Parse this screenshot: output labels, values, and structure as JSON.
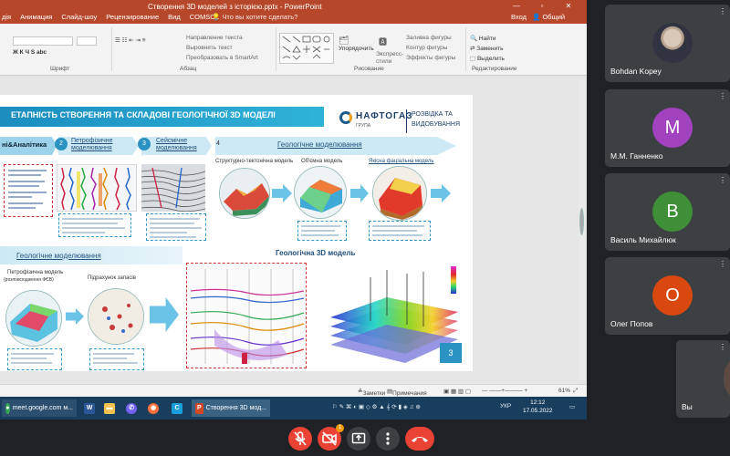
{
  "powerpoint": {
    "title": "Створення 3D моделей з історією.pptx - PowerPoint",
    "tabs": [
      "дія",
      "Анимация",
      "Слайд-шоу",
      "Рецензирование",
      "Вид",
      "COMSOL"
    ],
    "search_hint": "Что вы хотите сделать?",
    "login": "Вход",
    "share": "Общий доступ",
    "window_buttons": [
      "—",
      "▫",
      "✕"
    ],
    "ribbon": {
      "font_group": "Шрифт",
      "paragraph_group": "Абзац",
      "drawing_group": "Рисование",
      "editing_group": "Редактирование",
      "paragraph_items": [
        "Направление текста",
        "Выровнять текст",
        "Преобразовать в SmartArt"
      ],
      "arrange": "Упорядочить",
      "express_styles": "Экспресс-стили",
      "shape_items": [
        "Заливка фигуры",
        "Контур фигуры",
        "Эффекты фигуры"
      ],
      "editing_items": [
        "Найти",
        "Заменить",
        "Выделить"
      ]
    },
    "status": {
      "notes": "Заметки",
      "comments": "Примечания",
      "zoom": "61%"
    }
  },
  "slide": {
    "title": "ЕТАПНІСТЬ СТВОРЕННЯ ТА СКЛАДОВІ ГЕОЛОГІЧНОЇ 3D МОДЕЛІ",
    "logo_brand": "НАФТОГАЗ",
    "logo_sub": "ГРУПА",
    "logo_tag": [
      "РОЗВІДКА ТА",
      "ВИДОБУВАННЯ"
    ],
    "stages": [
      {
        "num": "",
        "label": "ні&Аналітика"
      },
      {
        "num": "2",
        "label": "Петрофізичне моделювання"
      },
      {
        "num": "3",
        "label": "Сейсмічне моделювання"
      },
      {
        "num": "4",
        "label": "Геологічне моделювання"
      }
    ],
    "sub_models": [
      "Структурно-тектонічна модель",
      "Об'ємна модель",
      "Якісна фаціальна модель"
    ],
    "band_label": "Геологічне моделювання",
    "model_3d_title": "Геологічна 3D модель",
    "petro_label": "Петрофізична модель",
    "petro_sub": "(розповсюдження ФЄВ)",
    "bcc_label": "Підрахунок запасів",
    "page_number": "3"
  },
  "taskbar": {
    "items": [
      {
        "label": "meet.google.com м...",
        "icon": "chrome-icon",
        "color": "#34a853"
      },
      {
        "label": "",
        "icon": "word-icon",
        "color": "#2b579a"
      },
      {
        "label": "",
        "icon": "explorer-icon",
        "color": "#f2c14e"
      },
      {
        "label": "",
        "icon": "viber-icon",
        "color": "#7360f2"
      },
      {
        "label": "",
        "icon": "firefox-icon",
        "color": "#ff7139"
      },
      {
        "label": "",
        "icon": "app-c-icon",
        "color": "#1a9fdb"
      },
      {
        "label": "Створення 3D мод...",
        "icon": "powerpoint-icon",
        "color": "#d24726"
      }
    ],
    "language": "УКР",
    "time": "12:12",
    "date": "17.05.2022"
  },
  "participants": [
    {
      "name": "Bohdan Kopey",
      "initial": "",
      "color": "#2f3440"
    },
    {
      "name": "М.М. Ганненко",
      "initial": "М",
      "color": "#a142bf"
    },
    {
      "name": "Василь Михайлюк",
      "initial": "В",
      "color": "#3f8f38"
    },
    {
      "name": "Олег Попов",
      "initial": "О",
      "color": "#d9480f"
    },
    {
      "name": "Вы",
      "initial": "",
      "color": "#3c4043"
    }
  ],
  "controls": {
    "badge_count": "1",
    "mic": "mic-off-icon",
    "camera": "camera-off-icon",
    "present": "present-icon",
    "more": "more-icon",
    "hangup": "hangup-icon"
  }
}
